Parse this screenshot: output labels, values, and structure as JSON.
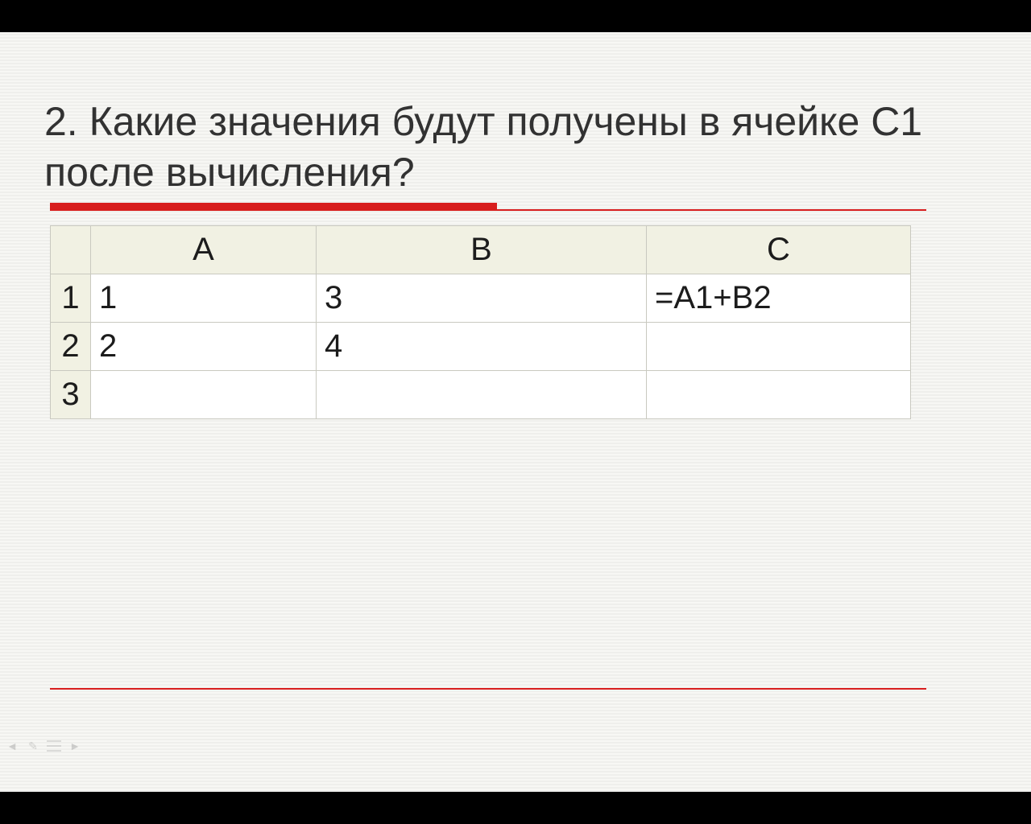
{
  "question": "2. Какие значения будут получены в ячейке С1 после вычисления?",
  "spreadsheet": {
    "columns": [
      "A",
      "B",
      "C"
    ],
    "row_headers": [
      "1",
      "2",
      "3"
    ],
    "rows": [
      {
        "A": "1",
        "B": "3",
        "C": "=A1+B2"
      },
      {
        "A": "2",
        "B": "4",
        "C": ""
      },
      {
        "A": "",
        "B": "",
        "C": ""
      }
    ]
  }
}
